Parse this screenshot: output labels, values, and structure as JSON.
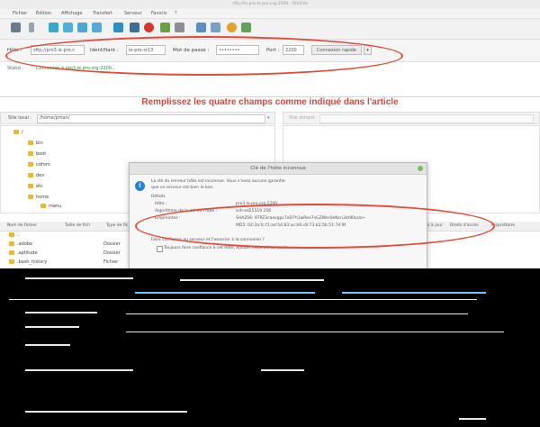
{
  "window": {
    "title": "sftp://le.pro-le.pro.org:2200 - FileZilla"
  },
  "menu": [
    "Fichier",
    "Édition",
    "Affichage",
    "Transfert",
    "Serveur",
    "Favoris",
    "?"
  ],
  "quickconnect": {
    "host_label": "Hôte :",
    "host_value": "sftp://pro3.le.pro.c",
    "user_label": "Identifiant :",
    "user_value": "le-pro-sr13",
    "pass_label": "Mot de passe :",
    "pass_value": "••••••••",
    "port_label": "Port :",
    "port_value": "2200",
    "connect_label": "Connexion rapide"
  },
  "log": {
    "status_label": "Statut :",
    "status_value": "Connexion à pro3.le.pro.org:2200..."
  },
  "annotation": "Remplissez les quatre champs comme indiqué dans l'article",
  "local": {
    "site_label": "Site local :",
    "site_path": "/home/pman/",
    "tree": [
      "/",
      "bin",
      "boot",
      "cdrom",
      "dev",
      "etc",
      "home",
      "manu"
    ]
  },
  "remote": {
    "site_label": "Site distant :"
  },
  "filelist": {
    "headers": [
      "Nom de fichier",
      "Taille de fich",
      "Type de fic"
    ],
    "rows": [
      {
        "name": "..",
        "type": ""
      },
      {
        "name": ".adobe",
        "type": "Dossier"
      },
      {
        "name": ".aptitude",
        "type": "Dossier"
      },
      {
        "name": ".bash_history",
        "type": "Fichier"
      }
    ],
    "remote_headers": [
      "Mis à jour",
      "Droits d'accès",
      "Propriétaire"
    ]
  },
  "dialog": {
    "title": "Clé de l'hôte inconnue",
    "intro1": "La clé du serveur hôte est inconnue. Vous n'avez aucune garantie",
    "intro2": "que ce serveur est bien le bon.",
    "details": "Détails",
    "host_label": "Hôte :",
    "host_value": "pro3.le.pro.org:2200",
    "algo_label": "Algorithme de la clé de l'hôte :",
    "algo_value": "ssh-ed25519 256",
    "fp_label": "Empreintes :",
    "fp_sha": "SHA256: 9TPZ3caexgpc7eD7h1wRee7vGZWer0eNcn3ot90ocb+",
    "fp_md5": "MD5: 02:3a:fc:f1:ad:54:83:ac:b6:c8:73:b2:5b:51:7d:9f",
    "question": "Faire confiance au serveur et l'associer à la connexion ?",
    "always": "Toujours faire confiance à cet hôte, ajouter cette clé au cache"
  },
  "colors": {
    "annotation": "#e0443a",
    "ellipse": "#e64a3a",
    "folder": "#e8b83a",
    "info": "#2a7ed3"
  }
}
